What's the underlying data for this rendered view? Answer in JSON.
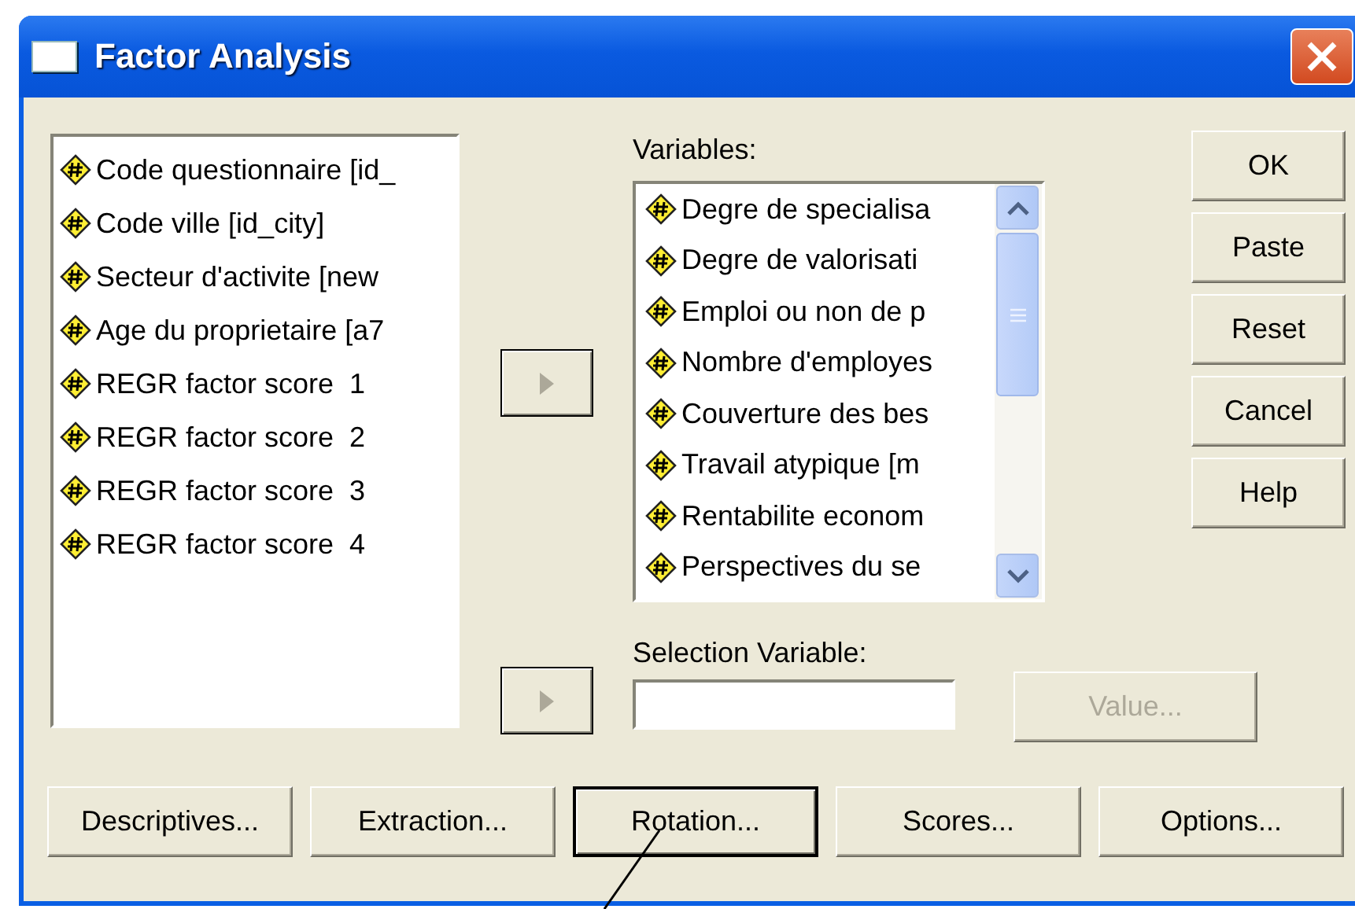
{
  "window": {
    "title": "Factor Analysis"
  },
  "source_list": [
    "Code questionnaire [id_",
    "Code ville [id_city]",
    "Secteur d'activite [new",
    "Age du proprietaire [a7",
    "REGR factor score  1",
    "REGR factor score  2",
    "REGR factor score  3",
    "REGR factor score  4"
  ],
  "variables": {
    "label": "Variables:",
    "items": [
      "Degre de specialisa",
      "Degre de valorisati",
      "Emploi ou non de p",
      "Nombre d'employes",
      "Couverture des bes",
      "Travail atypique [m",
      "Rentabilite econom",
      "Perspectives du se"
    ]
  },
  "selection_variable": {
    "label": "Selection Variable:",
    "value_button": {
      "label": "Value...",
      "disabled": true
    }
  },
  "side_buttons": [
    {
      "label": "OK",
      "default": false
    },
    {
      "label": "Paste",
      "default": false
    },
    {
      "label": "Reset",
      "default": false
    },
    {
      "label": "Cancel",
      "default": false
    },
    {
      "label": "Help",
      "default": false
    }
  ],
  "bottom_buttons": [
    {
      "label": "Descriptives...",
      "default": false
    },
    {
      "label": "Extraction...",
      "default": false
    },
    {
      "label": "Rotation...",
      "default": true
    },
    {
      "label": "Scores...",
      "default": false
    },
    {
      "label": "Options...",
      "default": false
    }
  ]
}
